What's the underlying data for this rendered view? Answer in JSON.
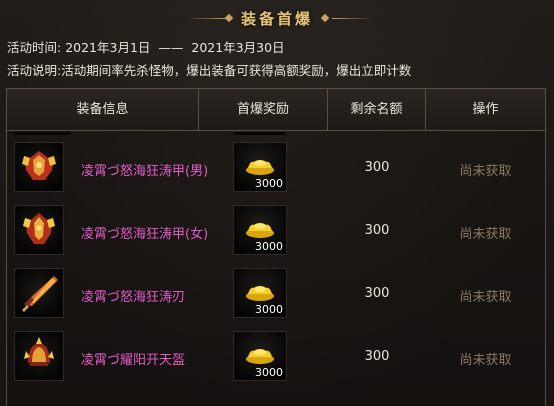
{
  "title": "装备首爆",
  "activity": {
    "time_label": "活动时间:",
    "time_start": "2021年3月1日",
    "time_sep": "——",
    "time_end": "2021年3月30日",
    "desc_label": "活动说明:",
    "desc_text": "活动期间率先杀怪物，爆出装备可获得高额奖励，爆出立即计数"
  },
  "table": {
    "headers": [
      "装备信息",
      "首爆奖励",
      "剩余名额",
      "操作"
    ],
    "rows": [
      {
        "item_name": "凌霄づ怒海狂涛甲(男)",
        "item_icon": "armor-male-icon",
        "reward_icon": "gold-ingot-icon",
        "reward_qty": "3000",
        "remaining": "300",
        "action": "尚未获取"
      },
      {
        "item_name": "凌霄づ怒海狂涛甲(女)",
        "item_icon": "armor-female-icon",
        "reward_icon": "gold-ingot-icon",
        "reward_qty": "3000",
        "remaining": "300",
        "action": "尚未获取"
      },
      {
        "item_name": "凌霄づ怒海狂涛刃",
        "item_icon": "blade-icon",
        "reward_icon": "gold-ingot-icon",
        "reward_qty": "3000",
        "remaining": "300",
        "action": "尚未获取"
      },
      {
        "item_name": "凌霄づ耀阳开天盔",
        "item_icon": "helmet-icon",
        "reward_icon": "gold-ingot-icon",
        "reward_qty": "3000",
        "remaining": "300",
        "action": "尚未获取"
      }
    ]
  },
  "colors": {
    "title": "#e9c37a",
    "item_name": "#e25bc9",
    "action_disabled": "#8a7a62",
    "border": "#5a4f43"
  }
}
